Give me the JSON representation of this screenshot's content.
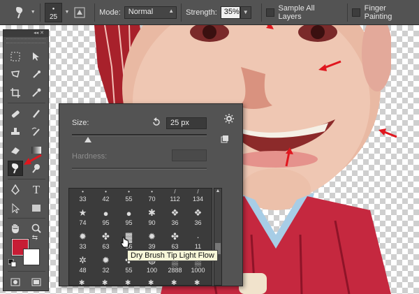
{
  "options_bar": {
    "brush_size": "25",
    "mode_label": "Mode:",
    "mode_value": "Normal",
    "strength_label": "Strength:",
    "strength_value": "35%",
    "sample_all_layers": "Sample All Layers",
    "finger_painting": "Finger Painting"
  },
  "brush_picker": {
    "size_label": "Size:",
    "size_value": "25 px",
    "hardness_label": "Hardness:",
    "brush_numbers": [
      [
        "33",
        "42",
        "55",
        "70",
        "112",
        "134"
      ],
      [
        "74",
        "95",
        "95",
        "90",
        "36",
        "36"
      ],
      [
        "33",
        "63",
        "66",
        "39",
        "63",
        "11"
      ],
      [
        "48",
        "32",
        "55",
        "100",
        "2888",
        "1000"
      ]
    ]
  },
  "tooltip": "Dry Brush Tip Light Flow",
  "colors": {
    "foreground": "#c71d35",
    "background": "#ffffff",
    "annotation_arrow": "#e0161e",
    "panel": "#535353"
  },
  "icons": [
    "smudge-tool-icon",
    "brush-preset-icon",
    "move-icon",
    "marquee-icon",
    "lasso-icon",
    "crop-icon",
    "eyedropper-icon",
    "healing-icon",
    "brush-icon",
    "stamp-icon",
    "history-brush-icon",
    "eraser-icon",
    "gradient-icon",
    "smudge-icon",
    "dodge-icon",
    "pen-icon",
    "type-icon",
    "path-selection-icon",
    "rectangle-icon",
    "hand-icon",
    "zoom-icon",
    "quick-mask-icon",
    "screen-mode-icon",
    "reset-icon",
    "gear-icon",
    "new-preset-icon"
  ]
}
